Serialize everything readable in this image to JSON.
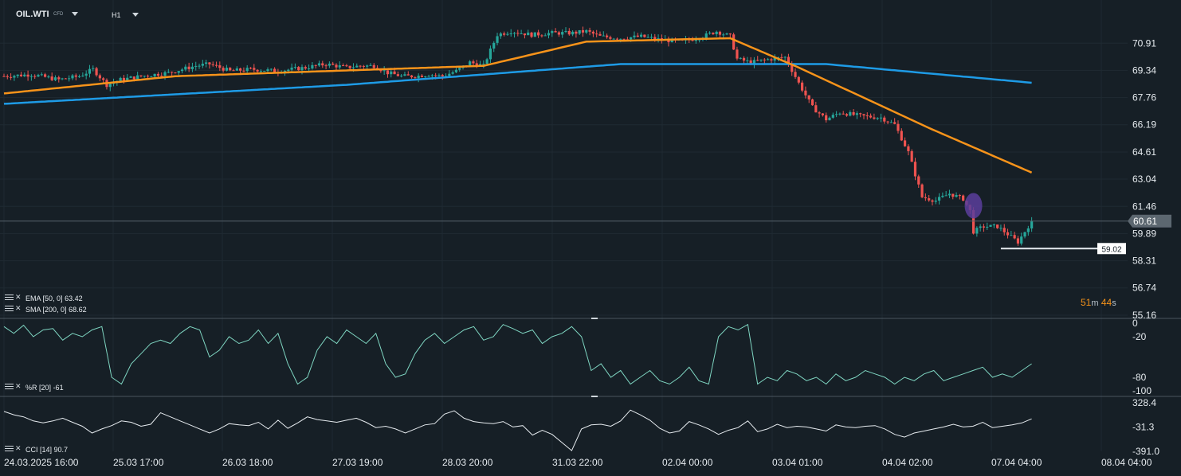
{
  "symbol": "OIL.WTI",
  "symbol_suffix": "CFD",
  "timeframe": "H1",
  "colors": {
    "background": "#161f26",
    "bull": "#26a69a",
    "bear": "#ef5350",
    "ema": "#f7931a",
    "sma": "#1e9be6",
    "indicator_line": "#7fd6c2",
    "cci_line": "#e6ebef",
    "current_price_tag": "#5c6770"
  },
  "indicators": {
    "ema": {
      "label": "EMA",
      "params": "[50, 0]",
      "value": "63.42"
    },
    "sma": {
      "label": "SMA",
      "params": "[200, 0]",
      "value": "68.62"
    },
    "wr": {
      "label": "%R",
      "params": "[20]",
      "value": "-61"
    },
    "cci": {
      "label": "CCI",
      "params": "[14]",
      "value": "90.7"
    }
  },
  "current_price": "60.61",
  "marker_price": "59.02",
  "timer": {
    "minutes": "51",
    "m_unit": "m",
    "seconds": "44",
    "s_unit": "s"
  },
  "chart_data": [
    {
      "type": "candlestick",
      "title": "OIL.WTI H1",
      "price_ticks": [
        "70.91",
        "69.34",
        "67.76",
        "66.19",
        "64.61",
        "63.04",
        "61.46",
        "59.89",
        "58.31",
        "56.74",
        "55.16"
      ],
      "ylim": [
        55.16,
        72.49
      ],
      "x_ticks": [
        "24.03.2025 16:00",
        "25.03 17:00",
        "26.03 18:00",
        "27.03 19:00",
        "28.03 20:00",
        "31.03 22:00",
        "02.04 00:00",
        "03.04 01:00",
        "04.04 02:00",
        "07.04 04:00",
        "08.04 04:00"
      ],
      "close_path": [
        [
          0,
          69.0
        ],
        [
          8,
          69.1
        ],
        [
          16,
          68.8
        ],
        [
          22,
          69.0
        ],
        [
          26,
          69.4
        ],
        [
          30,
          68.5
        ],
        [
          34,
          68.8
        ],
        [
          40,
          69.0
        ],
        [
          48,
          69.2
        ],
        [
          56,
          69.6
        ],
        [
          60,
          69.7
        ],
        [
          66,
          69.3
        ],
        [
          72,
          69.4
        ],
        [
          80,
          69.3
        ],
        [
          88,
          69.5
        ],
        [
          94,
          69.7
        ],
        [
          100,
          69.5
        ],
        [
          104,
          69.6
        ],
        [
          108,
          69.6
        ],
        [
          112,
          69.2
        ],
        [
          116,
          69.0
        ],
        [
          120,
          69.0
        ],
        [
          124,
          69.1
        ],
        [
          128,
          69.0
        ],
        [
          132,
          69.3
        ],
        [
          136,
          69.8
        ],
        [
          140,
          69.6
        ],
        [
          144,
          71.4
        ],
        [
          148,
          71.6
        ],
        [
          154,
          71.4
        ],
        [
          160,
          71.5
        ],
        [
          166,
          71.5
        ],
        [
          170,
          71.6
        ],
        [
          174,
          71.3
        ],
        [
          180,
          71.2
        ],
        [
          186,
          71.3
        ],
        [
          192,
          71.1
        ],
        [
          198,
          71.0
        ],
        [
          204,
          71.3
        ],
        [
          208,
          71.6
        ],
        [
          212,
          71.3
        ],
        [
          214,
          70.0
        ],
        [
          218,
          69.8
        ],
        [
          224,
          70.0
        ],
        [
          228,
          70.1
        ],
        [
          232,
          68.6
        ],
        [
          236,
          67.2
        ],
        [
          240,
          66.5
        ],
        [
          244,
          66.9
        ],
        [
          250,
          66.7
        ],
        [
          256,
          66.6
        ],
        [
          260,
          66.2
        ],
        [
          264,
          64.6
        ],
        [
          268,
          62.0
        ],
        [
          272,
          61.8
        ],
        [
          276,
          62.2
        ],
        [
          280,
          61.9
        ],
        [
          282,
          61.2
        ],
        [
          283,
          60.0
        ],
        [
          286,
          60.3
        ],
        [
          290,
          60.3
        ],
        [
          294,
          59.7
        ],
        [
          296,
          59.4
        ],
        [
          300,
          60.61
        ]
      ],
      "ema": [
        [
          0,
          68.0
        ],
        [
          50,
          69.0
        ],
        [
          140,
          69.6
        ],
        [
          170,
          71.0
        ],
        [
          212,
          71.2
        ],
        [
          232,
          69.5
        ],
        [
          270,
          66.0
        ],
        [
          300,
          63.42
        ]
      ],
      "sma": [
        [
          0,
          67.4
        ],
        [
          100,
          68.5
        ],
        [
          180,
          69.7
        ],
        [
          240,
          69.7
        ],
        [
          300,
          68.62
        ]
      ],
      "last": 60.61
    },
    {
      "type": "line",
      "title": "%R [20]",
      "y_ticks": [
        "0",
        "-20",
        "-80",
        "-100"
      ],
      "ylim": [
        -100,
        0
      ],
      "values": [
        -5,
        -15,
        -3,
        -20,
        -10,
        -8,
        -25,
        -15,
        -20,
        -10,
        -5,
        -80,
        -90,
        -60,
        -45,
        -30,
        -25,
        -30,
        -15,
        -5,
        -10,
        -50,
        -40,
        -20,
        -30,
        -25,
        -10,
        -30,
        -15,
        -60,
        -90,
        -80,
        -40,
        -20,
        -30,
        -10,
        -20,
        -30,
        -15,
        -60,
        -80,
        -75,
        -45,
        -25,
        -15,
        -30,
        -20,
        -10,
        -5,
        -25,
        -20,
        -2,
        -8,
        -15,
        -10,
        -30,
        -20,
        -15,
        -5,
        -20,
        -70,
        -60,
        -80,
        -70,
        -90,
        -80,
        -70,
        -85,
        -90,
        -80,
        -65,
        -85,
        -90,
        -20,
        -5,
        -10,
        -2,
        -90,
        -80,
        -85,
        -70,
        -75,
        -85,
        -80,
        -90,
        -75,
        -85,
        -80,
        -70,
        -75,
        -80,
        -90,
        -80,
        -85,
        -75,
        -70,
        -85,
        -80,
        -75,
        -70,
        -65,
        -80,
        -75,
        -80,
        -70,
        -60
      ]
    },
    {
      "type": "line",
      "title": "CCI [14]",
      "y_ticks": [
        "328.4",
        "-31.3",
        "-391.0"
      ],
      "ylim": [
        -391.0,
        328.4
      ],
      "values": [
        200,
        150,
        120,
        60,
        30,
        60,
        100,
        40,
        -20,
        -120,
        -60,
        -10,
        60,
        40,
        -20,
        10,
        180,
        120,
        60,
        0,
        -60,
        -120,
        -60,
        20,
        0,
        -10,
        40,
        -60,
        70,
        -50,
        30,
        120,
        80,
        60,
        40,
        70,
        100,
        40,
        -40,
        -20,
        -60,
        -120,
        -60,
        0,
        20,
        160,
        210,
        100,
        50,
        30,
        20,
        50,
        -30,
        -10,
        -150,
        -80,
        -140,
        -260,
        -380,
        -60,
        0,
        10,
        -20,
        60,
        220,
        150,
        70,
        -50,
        -120,
        -90,
        50,
        0,
        -60,
        -140,
        -80,
        -40,
        60,
        -100,
        -60,
        10,
        -40,
        -20,
        -30,
        -60,
        -90,
        0,
        -30,
        -40,
        -20,
        -10,
        -60,
        -140,
        -180,
        -120,
        -90,
        -60,
        -30,
        10,
        -30,
        -20,
        40,
        -40,
        -20,
        0,
        30,
        90.7
      ]
    }
  ]
}
